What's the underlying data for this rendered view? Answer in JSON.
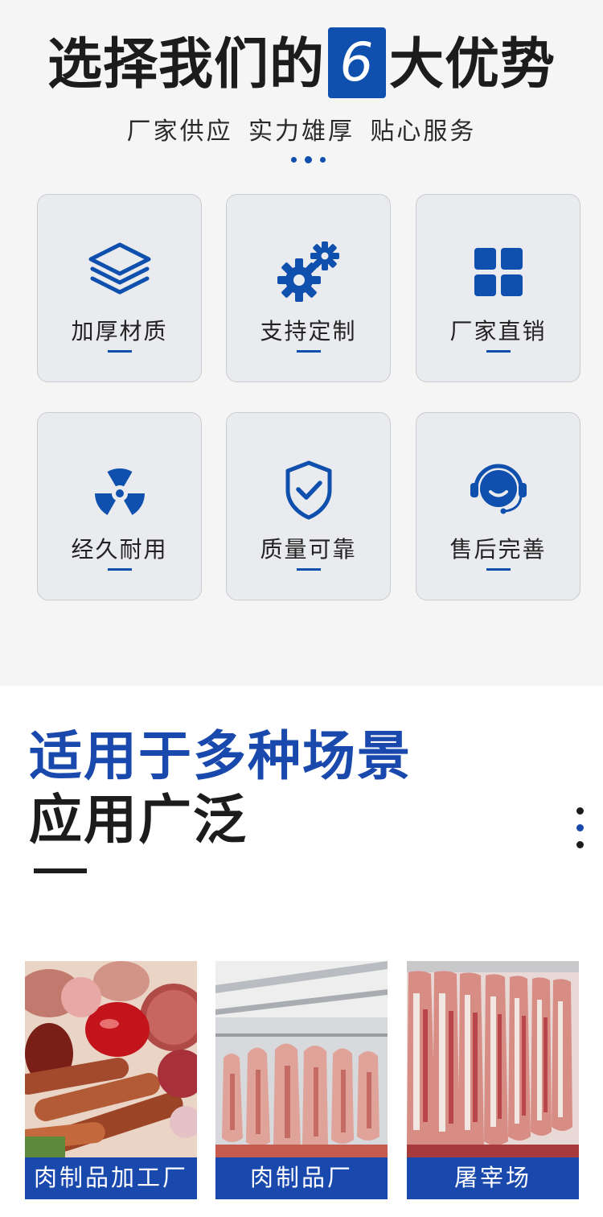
{
  "advantages": {
    "title_before": "选择我们的",
    "title_number": "6",
    "title_after": "大优势",
    "subtitle": "厂家供应 实力雄厚  贴心服务",
    "items": [
      {
        "label": "加厚材质",
        "icon": "layers-icon"
      },
      {
        "label": "支持定制",
        "icon": "gears-icon"
      },
      {
        "label": "厂家直销",
        "icon": "grid-icon"
      },
      {
        "label": "经久耐用",
        "icon": "radiation-icon"
      },
      {
        "label": "质量可靠",
        "icon": "shield-check-icon"
      },
      {
        "label": "售后完善",
        "icon": "headset-icon"
      }
    ],
    "accent_color": "#0f4fae"
  },
  "applications": {
    "title_line1": "适用于多种场景",
    "title_line2": "应用广泛",
    "scenes": [
      {
        "caption": "肉制品加工厂"
      },
      {
        "caption": "肉制品厂"
      },
      {
        "caption": "屠宰场"
      }
    ],
    "accent_color": "#1a49ae"
  }
}
